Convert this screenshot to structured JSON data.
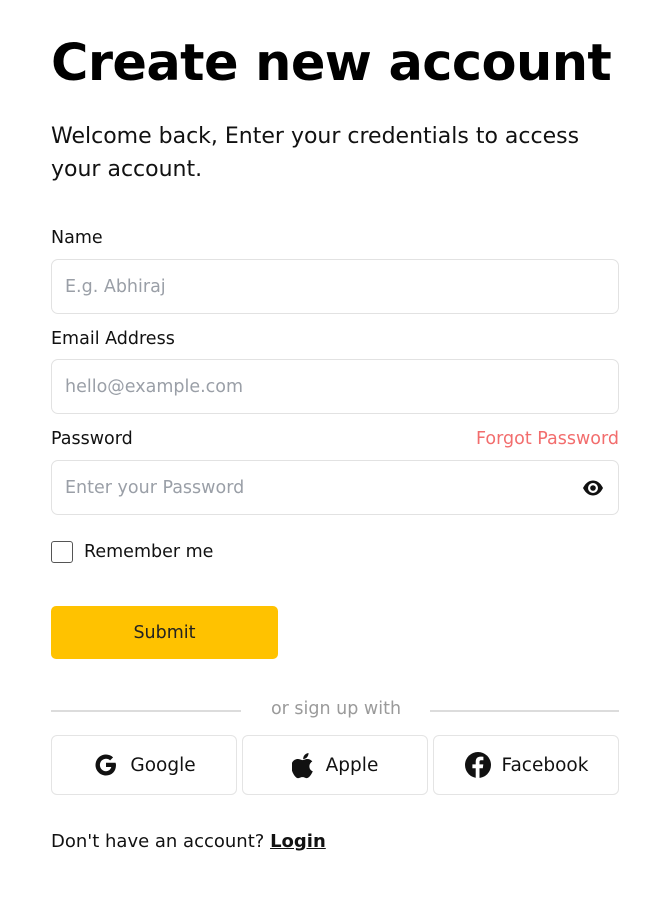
{
  "header": {
    "title": "Create new account",
    "subtitle": "Welcome back, Enter your credentials to access your account."
  },
  "form": {
    "name_label": "Name",
    "name_placeholder": "E.g. Abhiraj",
    "email_label": "Email Address",
    "email_placeholder": "hello@example.com",
    "password_label": "Password",
    "forgot_password": "Forgot Password",
    "password_placeholder": "Enter your Password",
    "remember_me": "Remember me",
    "submit_label": "Submit"
  },
  "social": {
    "divider_text": "or sign up with",
    "buttons": [
      {
        "label": "Google",
        "icon": "google-icon"
      },
      {
        "label": "Apple",
        "icon": "apple-icon"
      },
      {
        "label": "Facebook",
        "icon": "facebook-icon"
      }
    ]
  },
  "footer": {
    "prompt": "Don't have an account?",
    "login_link": "Login"
  },
  "colors": {
    "accent": "#ffc200",
    "link": "#f26d6d",
    "border": "#e2e2e2",
    "placeholder": "#9a9fa7"
  }
}
